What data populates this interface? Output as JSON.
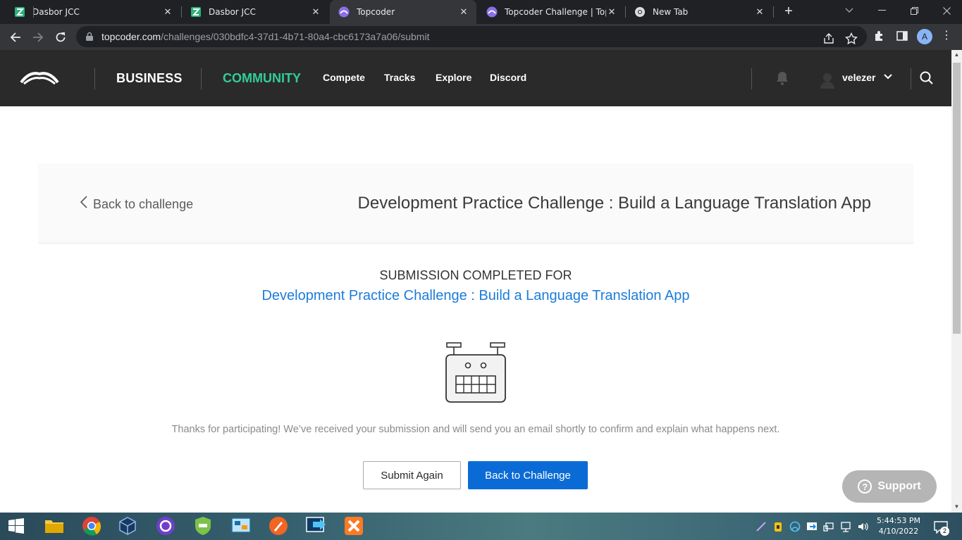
{
  "browser": {
    "tabs": [
      {
        "title": "Dasbor JCC",
        "icon": "jcc-icon"
      },
      {
        "title": "Dasbor JCC",
        "icon": "jcc-icon"
      },
      {
        "title": "Topcoder",
        "icon": "topcoder-icon",
        "active": true
      },
      {
        "title": "Topcoder Challenge | Topco",
        "icon": "topcoder-icon"
      },
      {
        "title": "New Tab",
        "icon": "chrome-icon"
      }
    ],
    "url_host": "topcoder.com",
    "url_path": "/challenges/030bdfc4-37d1-4b71-80a4-cbc6173a7a06/submit",
    "profile_initial": "A"
  },
  "header": {
    "business": "BUSINESS",
    "community": "COMMUNITY",
    "nav": [
      "Compete",
      "Tracks",
      "Explore",
      "Discord"
    ],
    "username": "velezer",
    "community_color": "#33cc99"
  },
  "challenge_bar": {
    "back_label": "Back to challenge",
    "title": "Development Practice Challenge : Build a Language Translation App"
  },
  "confirmation": {
    "heading": "SUBMISSION COMPLETED FOR",
    "challenge_link": "Development Practice Challenge : Build a Language Translation App",
    "message": "Thanks for participating! We’ve received your submission and will send you an email shortly to confirm and explain what happens next.",
    "submit_again": "Submit Again",
    "back_to_challenge": "Back to Challenge",
    "primary_color": "#0b6bd6"
  },
  "support": {
    "label": "Support"
  },
  "taskbar": {
    "time": "5:44:53 PM",
    "date": "4/10/2022",
    "notification_count": "2",
    "apps": [
      "windows-start-icon",
      "file-explorer-icon",
      "chrome-icon",
      "virtualbox-icon",
      "github-desktop-icon",
      "vpn-icon",
      "network-tool-icon",
      "paint-icon",
      "remote-desktop-icon",
      "xampp-icon"
    ]
  }
}
